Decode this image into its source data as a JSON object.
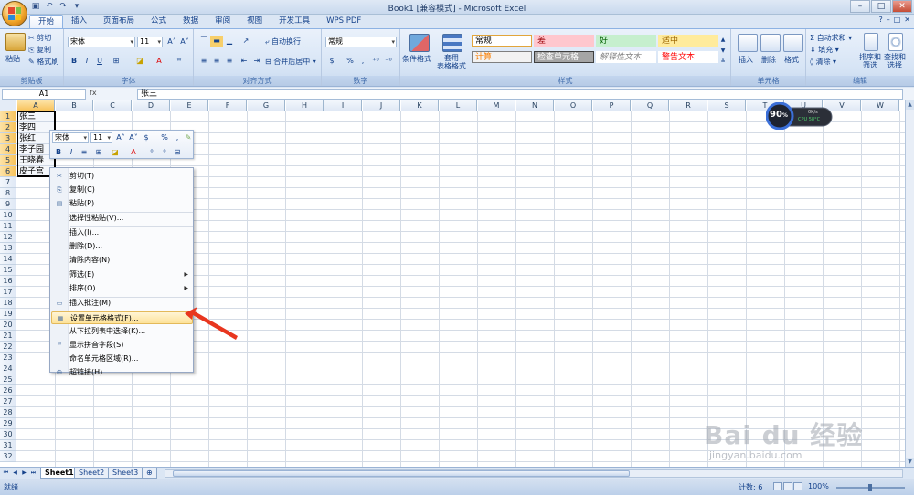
{
  "window": {
    "title": "Book1  [兼容模式] - Microsoft Excel",
    "qat_icons": [
      "save-icon",
      "undo-icon",
      "redo-icon",
      "customize-icon"
    ]
  },
  "ribbon_tabs": [
    "开始",
    "插入",
    "页面布局",
    "公式",
    "数据",
    "审阅",
    "视图",
    "开发工具",
    "WPS PDF"
  ],
  "active_tab": "开始",
  "clipboard": {
    "paste": "粘贴",
    "cut": "剪切",
    "copy": "复制",
    "format_painter": "格式刷",
    "label": "剪贴板"
  },
  "font": {
    "name": "宋体",
    "size": "11",
    "label": "字体",
    "bold": "B",
    "italic": "I",
    "underline": "U"
  },
  "alignment": {
    "wrap": "自动换行",
    "merge": "合并后居中",
    "label": "对齐方式"
  },
  "number": {
    "format": "常规",
    "percent": "%",
    "comma": ",",
    "label": "数字"
  },
  "styles": {
    "conditional": "条件格式",
    "table": "套用\n表格格式",
    "cells": [
      {
        "text": "常规",
        "bg": "#ffffff",
        "fg": "#000000",
        "border": "#e2a53b"
      },
      {
        "text": "差",
        "bg": "#ffc7ce",
        "fg": "#9c0006",
        "border": "#ffc7ce"
      },
      {
        "text": "好",
        "bg": "#c6efce",
        "fg": "#006100",
        "border": "#c6efce"
      },
      {
        "text": "适中",
        "bg": "#ffeb9c",
        "fg": "#9c6500",
        "border": "#ffeb9c"
      },
      {
        "text": "计算",
        "bg": "#f2f2f2",
        "fg": "#fa7d00",
        "border": "#7f7f7f"
      },
      {
        "text": "检查单元格",
        "bg": "#a5a5a5",
        "fg": "#ffffff",
        "border": "#3f3f3f"
      },
      {
        "text": "解释性文本",
        "bg": "#ffffff",
        "fg": "#7f7f7f",
        "border": "#ffffff"
      },
      {
        "text": "警告文本",
        "bg": "#ffffff",
        "fg": "#ff0000",
        "border": "#ffffff"
      }
    ],
    "label": "样式"
  },
  "cells_group": {
    "insert": "插入",
    "delete": "删除",
    "format": "格式",
    "label": "单元格"
  },
  "editing": {
    "autosum": "自动求和",
    "fill": "填充",
    "clear": "清除",
    "sort": "排序和\n筛选",
    "find": "查找和\n选择",
    "label": "编辑"
  },
  "formula_bar": {
    "name_box": "A1",
    "fx": "fx",
    "content": "张三"
  },
  "columns": [
    "A",
    "B",
    "C",
    "D",
    "E",
    "F",
    "G",
    "H",
    "I",
    "J",
    "K",
    "L",
    "M",
    "N",
    "O",
    "P",
    "Q",
    "R",
    "S",
    "T",
    "U",
    "V",
    "W"
  ],
  "rows": [
    "1",
    "2",
    "3",
    "4",
    "5",
    "6",
    "7",
    "8",
    "9",
    "10",
    "11",
    "12",
    "13",
    "14",
    "15",
    "16",
    "17",
    "18",
    "19",
    "20",
    "21",
    "22",
    "23",
    "24",
    "25",
    "26",
    "27",
    "28",
    "29",
    "30",
    "31",
    "32"
  ],
  "cell_values": [
    "张三",
    "李四",
    "张红",
    "李子园",
    "王晓春",
    "皮子宫"
  ],
  "mini_toolbar": {
    "font": "宋体",
    "size": "11"
  },
  "context_menu": [
    {
      "label": "剪切(T)",
      "icon": "scissors-icon"
    },
    {
      "label": "复制(C)",
      "icon": "copy-icon"
    },
    {
      "label": "粘贴(P)",
      "icon": "paste-icon"
    },
    {
      "label": "选择性粘贴(V)...",
      "icon": ""
    },
    {
      "label": "插入(I)...",
      "icon": ""
    },
    {
      "label": "删除(D)...",
      "icon": ""
    },
    {
      "label": "清除内容(N)",
      "icon": ""
    },
    {
      "label": "筛选(E)",
      "icon": "",
      "sub": true
    },
    {
      "label": "排序(O)",
      "icon": "",
      "sub": true
    },
    {
      "label": "插入批注(M)",
      "icon": "comment-icon"
    },
    {
      "label": "设置单元格格式(F)...",
      "icon": "format-cells-icon",
      "highlighted": true
    },
    {
      "label": "从下拉列表中选择(K)...",
      "icon": ""
    },
    {
      "label": "显示拼音字段(S)",
      "icon": "phonetic-icon"
    },
    {
      "label": "命名单元格区域(R)...",
      "icon": ""
    },
    {
      "label": "超链接(H)...",
      "icon": "hyperlink-icon"
    }
  ],
  "sheets": [
    "Sheet1",
    "Sheet2",
    "Sheet3"
  ],
  "active_sheet": "Sheet1",
  "status": {
    "mode": "就绪",
    "count": "计数: 6",
    "zoom": "100%"
  },
  "widget": {
    "percent": "90",
    "unit": "%",
    "speed": "0K/s",
    "temp": "CPU 58°C"
  },
  "watermark": {
    "brand": "Bai du 经验",
    "url": "jingyan.baidu.com"
  }
}
